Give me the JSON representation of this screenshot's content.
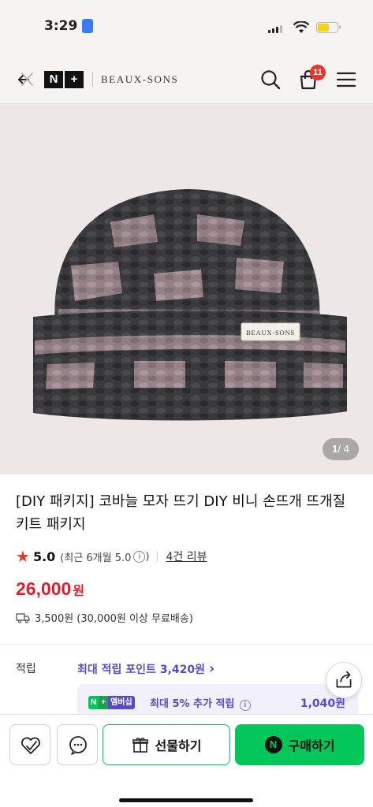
{
  "status_bar": {
    "time": "3:29",
    "battery_level": 0.55,
    "battery_color": "#f2d21a"
  },
  "header": {
    "logo_n": "N",
    "logo_plus": "+",
    "brand": "BEAUX-SONS",
    "cart_count": "11",
    "icons": [
      "back-close-icon",
      "search-icon",
      "shopping-bag-icon",
      "menu-icon"
    ]
  },
  "gallery": {
    "counter_current": "1",
    "counter_total": "/ 4",
    "hat_label": "BEAUX-SONS"
  },
  "product": {
    "title_line1": "[DIY 패키지] 코바늘 모자 뜨기 DIY 비니 손뜨개 뜨개질",
    "title_line2": "키트 패키지",
    "rating": "5.0",
    "rating_period": "(최근 6개월 5.0",
    "rating_period_close": ")",
    "reviews": "4건 리뷰",
    "price": "26,000",
    "price_unit": "원",
    "shipping": "3,500원 (30,000원 이상 무료배송)"
  },
  "points": {
    "label": "적립",
    "max_points": "최대 적립 포인트 3,420원",
    "chevron": "›",
    "membership_chip_n": "N",
    "membership_chip_plus": "+",
    "membership_chip_text": "멤버십",
    "membership_text": "최대 5% 추가 적립",
    "membership_amount": "1,040원"
  },
  "bottom_bar": {
    "gift_label": "선물하기",
    "buy_label": "구매하기",
    "npay_letter": "N"
  },
  "colors": {
    "accent_green": "#03c75a",
    "price_red": "#e11d2e",
    "point_purple": "#5b48c9",
    "badge_red": "#e6362b"
  }
}
